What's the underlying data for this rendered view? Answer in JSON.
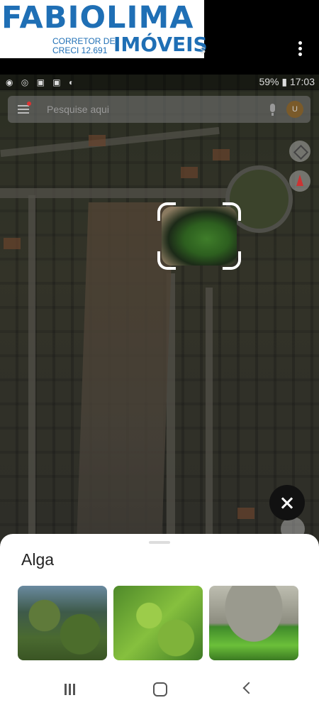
{
  "logo": {
    "brand": "FABIOLIMA",
    "subtitle_line1": "CORRETOR DE",
    "subtitle_line2": "CRECI 12.691",
    "brand_suffix": "IMÓVEIS"
  },
  "topbar": {
    "title_tail": "s"
  },
  "statusbar": {
    "left_icons": "◉ ◎ ▣ ▣ ◐",
    "right_text": "59% ▮ 17:03"
  },
  "search": {
    "placeholder": "Pesquise aqui",
    "avatar_letter": "U"
  },
  "sheet": {
    "title": "Alga"
  },
  "colors": {
    "brand": "#1f6fb5",
    "sheet_bg": "#ffffff",
    "close_button_bg": "#111111"
  }
}
